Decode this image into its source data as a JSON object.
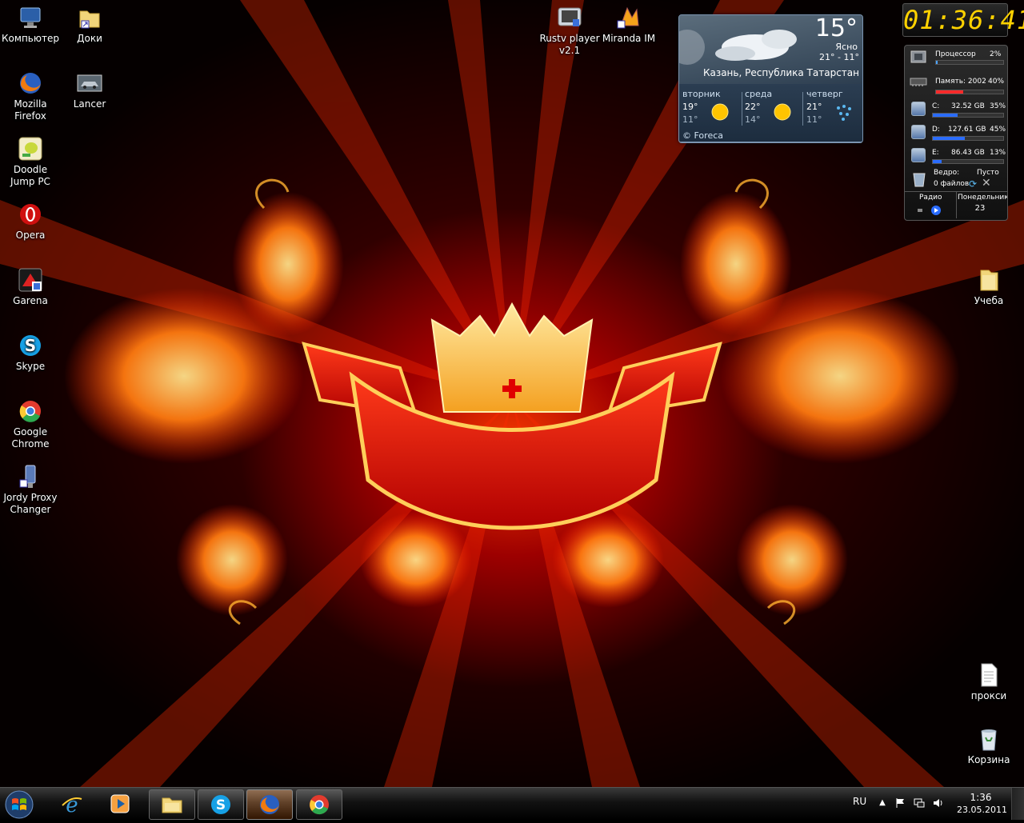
{
  "desktop": {
    "left_icons": [
      {
        "label": "Компьютер",
        "icon": "computer-icon"
      },
      {
        "label": "Доки",
        "icon": "folder-shortcut-icon"
      },
      {
        "label": "Mozilla Firefox",
        "icon": "firefox-icon"
      },
      {
        "label": "Lancer",
        "icon": "car-icon"
      },
      {
        "label": "Doodle Jump PC",
        "icon": "doodle-jump-icon"
      },
      {
        "label": "Opera",
        "icon": "opera-icon"
      },
      {
        "label": "Garena",
        "icon": "garena-icon"
      },
      {
        "label": "Skype",
        "icon": "skype-icon"
      },
      {
        "label": "Google Chrome",
        "icon": "chrome-icon"
      },
      {
        "label": "Jordy Proxy Changer",
        "icon": "proxy-icon"
      }
    ],
    "top_icons": [
      {
        "label": "Rustv player v2.1",
        "icon": "tv-player-icon"
      },
      {
        "label": "Miranda IM",
        "icon": "miranda-icon"
      }
    ],
    "right_icons": [
      {
        "label": "Учеба",
        "icon": "folder-icon"
      },
      {
        "label": "прокси",
        "icon": "text-file-icon"
      },
      {
        "label": "Корзина",
        "icon": "recycle-bin-icon"
      }
    ]
  },
  "weather": {
    "temp": "15°",
    "condition": "Ясно",
    "range": "21° - 11°",
    "city": "Казань, Республика Татарстан",
    "forecast": [
      {
        "day": "вторник",
        "hi": "19°",
        "lo": "11°",
        "icon": "sun-icon"
      },
      {
        "day": "среда",
        "hi": "22°",
        "lo": "14°",
        "icon": "sun-icon"
      },
      {
        "day": "четверг",
        "hi": "21°",
        "lo": "11°",
        "icon": "rain-icon"
      }
    ],
    "brand": "© Foreca"
  },
  "clock": {
    "time": "01:36:41"
  },
  "sysmon": {
    "cpu_label": "Процессор",
    "cpu_value": "2%",
    "cpu_level": 0.02,
    "mem_label": "Память: 2002",
    "mem_value": "40%",
    "mem_level": 0.4,
    "drives": [
      {
        "letter": "C:",
        "size": "32.52 GB",
        "pct": "35%",
        "level": 0.35
      },
      {
        "letter": "D:",
        "size": "127.61 GB",
        "pct": "45%",
        "level": 0.45
      },
      {
        "letter": "E:",
        "size": "86.43 GB",
        "pct": "13%",
        "level": 0.13
      }
    ],
    "bin_label": "Ведро:",
    "bin_state": "Пусто",
    "bin_files": "0 файлов",
    "radio_label": "Радио",
    "day_label": "Понедельник",
    "day_number": "23"
  },
  "taskbar": {
    "items": [
      {
        "name": "taskbar-ie",
        "icon": "internet-explorer-icon",
        "state": "pinned"
      },
      {
        "name": "taskbar-media-player",
        "icon": "media-player-icon",
        "state": "pinned"
      },
      {
        "name": "taskbar-explorer",
        "icon": "explorer-icon",
        "state": "open"
      },
      {
        "name": "taskbar-skype",
        "icon": "skype-icon",
        "state": "open"
      },
      {
        "name": "taskbar-firefox",
        "icon": "firefox-icon",
        "state": "active"
      },
      {
        "name": "taskbar-chrome",
        "icon": "chrome-icon",
        "state": "open"
      }
    ],
    "language": "RU",
    "time": "1:36",
    "date": "23.05.2011"
  },
  "colors": {
    "accent_clock": "#ffd200",
    "cpu_bar": "#4aa3ff",
    "mem_bar": "#ff2a2a",
    "drive_bar": "#2a6cff"
  }
}
